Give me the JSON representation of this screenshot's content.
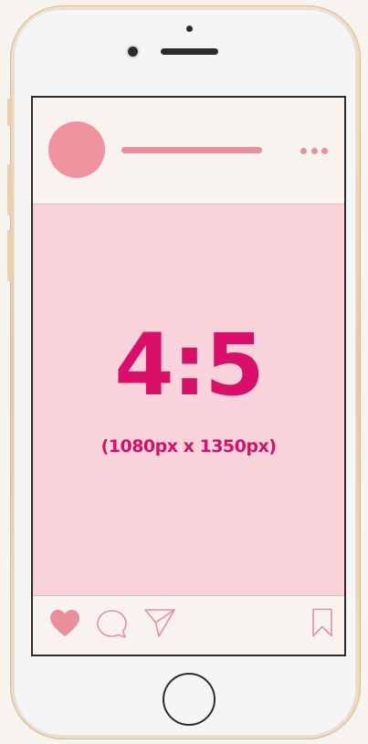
{
  "post": {
    "ratio": "4:5",
    "dimensions": "(1080px x 1350px)"
  },
  "icons": {
    "like": "heart-icon",
    "comment": "comment-icon",
    "share": "paper-plane-icon",
    "save": "bookmark-icon",
    "more": "more-options-icon"
  },
  "colors": {
    "accent": "#d90f6a",
    "pink_light": "#f8d3d9",
    "pink_mid": "#ec8d9a",
    "frame_gold": "#e6c9a6",
    "background": "#f7f3ee"
  }
}
